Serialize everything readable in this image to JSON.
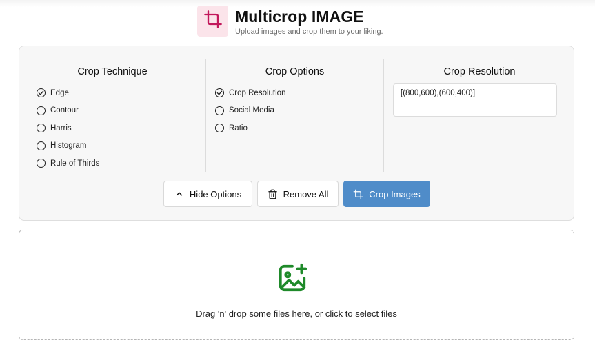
{
  "app": {
    "title": "Multicrop IMAGE",
    "subtitle": "Upload images and crop them to your liking.",
    "logo_icon": "crop-icon",
    "logo_bg": "#fbe4ea",
    "logo_color": "#c2185b"
  },
  "technique": {
    "title": "Crop Technique",
    "options": [
      {
        "label": "Edge",
        "checked": true
      },
      {
        "label": "Contour",
        "checked": false
      },
      {
        "label": "Harris",
        "checked": false
      },
      {
        "label": "Histogram",
        "checked": false
      },
      {
        "label": "Rule of Thirds",
        "checked": false
      }
    ]
  },
  "options": {
    "title": "Crop Options",
    "options": [
      {
        "label": "Crop Resolution",
        "checked": true
      },
      {
        "label": "Social Media",
        "checked": false
      },
      {
        "label": "Ratio",
        "checked": false
      }
    ]
  },
  "resolution": {
    "title": "Crop Resolution",
    "value": "[(800,600),(600,400)]"
  },
  "buttons": {
    "hide": "Hide Options",
    "remove": "Remove All",
    "crop": "Crop Images",
    "hide_icon": "chevron-up-icon",
    "remove_icon": "trash-icon",
    "crop_icon": "crop-icon",
    "crop_color": "#4f8cc9"
  },
  "dropzone": {
    "text": "Drag 'n' drop some files here, or click to select files",
    "icon": "image-add-icon",
    "icon_color": "#1f8a2a"
  }
}
